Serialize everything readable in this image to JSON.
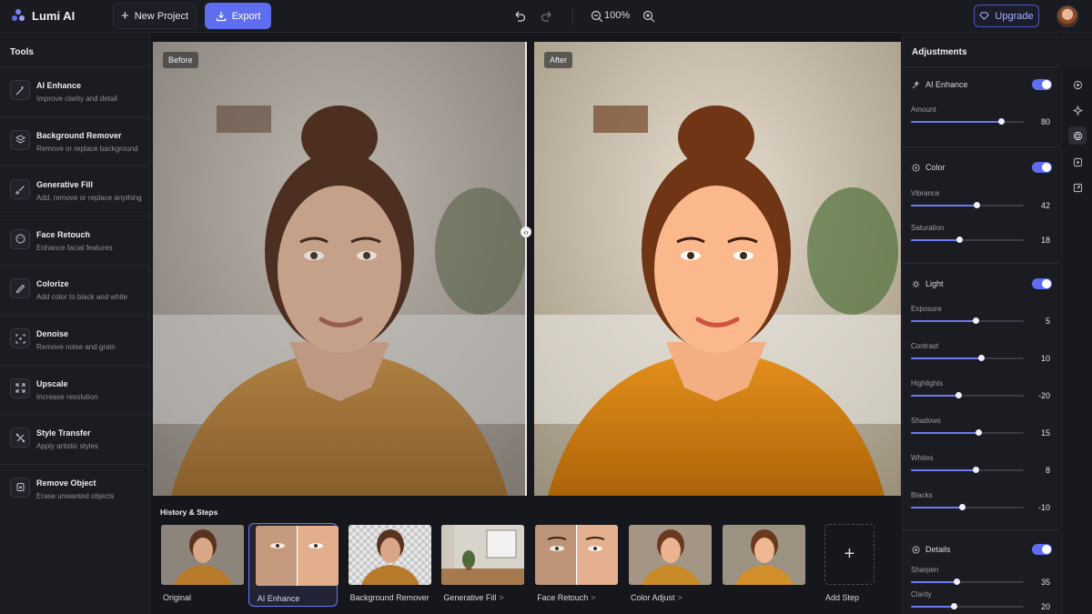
{
  "app": {
    "name": "Lumi AI"
  },
  "toolbar": {
    "new_project": "New Project",
    "export": "Export",
    "zoom": "100%",
    "upgrade": "Upgrade"
  },
  "tools": {
    "title": "Tools",
    "items": [
      {
        "title": "AI Enhance",
        "subtitle": "Improve clarity and detail",
        "icon": "magic-wand-icon"
      },
      {
        "title": "Background Remover",
        "subtitle": "Remove or replace background",
        "icon": "layers-icon"
      },
      {
        "title": "Generative Fill",
        "subtitle": "Add, remove or replace anything",
        "icon": "brush-icon"
      },
      {
        "title": "Face Retouch",
        "subtitle": "Enhance facial features",
        "icon": "face-icon"
      },
      {
        "title": "Colorize",
        "subtitle": "Add color to black and white",
        "icon": "pen-icon"
      },
      {
        "title": "Denoise",
        "subtitle": "Remove noise and grain",
        "icon": "denoise-icon"
      },
      {
        "title": "Upscale",
        "subtitle": "Increase resolution",
        "icon": "expand-icon"
      },
      {
        "title": "Style Transfer",
        "subtitle": "Apply artistic styles",
        "icon": "style-icon"
      },
      {
        "title": "Remove Object",
        "subtitle": "Erase unwanted objects",
        "icon": "eraser-icon"
      }
    ]
  },
  "canvas": {
    "before_label": "Before",
    "after_label": "After",
    "split_percent": 50
  },
  "history": {
    "title": "History & Steps",
    "steps": [
      {
        "label": "Original",
        "chevron": "",
        "active": false
      },
      {
        "label": "AI Enhance",
        "chevron": "",
        "active": true
      },
      {
        "label": "Background Remover",
        "chevron": "",
        "active": false
      },
      {
        "label": "Generative Fill",
        "chevron": ">",
        "active": false
      },
      {
        "label": "Face Retouch",
        "chevron": ">",
        "active": false
      },
      {
        "label": "Color Adjust",
        "chevron": ">",
        "active": false
      },
      {
        "label": "",
        "chevron": "",
        "active": false
      }
    ],
    "add_step": "Add Step"
  },
  "adjustments": {
    "title": "Adjustments",
    "ai_enhance": {
      "title": "AI Enhance",
      "enabled": true,
      "amount_label": "Amount",
      "amount": "80",
      "amount_fraction": 0.8
    },
    "color": {
      "title": "Color",
      "enabled": true,
      "sliders": [
        {
          "label": "Vibrance",
          "value": "42",
          "fraction": 0.58
        },
        {
          "label": "Saturation",
          "value": "18",
          "fraction": 0.43
        }
      ]
    },
    "light": {
      "title": "Light",
      "enabled": true,
      "sliders": [
        {
          "label": "Exposure",
          "value": "5",
          "fraction": 0.57
        },
        {
          "label": "Contrast",
          "value": "10",
          "fraction": 0.62
        },
        {
          "label": "Highlights",
          "value": "-20",
          "fraction": 0.42
        },
        {
          "label": "Shadows",
          "value": "15",
          "fraction": 0.6
        },
        {
          "label": "Whites",
          "value": "8",
          "fraction": 0.57
        },
        {
          "label": "Blacks",
          "value": "-10",
          "fraction": 0.45
        }
      ]
    },
    "details": {
      "title": "Details",
      "enabled": true,
      "sliders": [
        {
          "label": "Sharpen",
          "value": "35",
          "fraction": 0.4
        },
        {
          "label": "Clarity",
          "value": "20",
          "fraction": 0.38
        }
      ]
    }
  },
  "colors": {
    "accent": "#5f6ef0",
    "upgrade": "#a9b2ff"
  }
}
